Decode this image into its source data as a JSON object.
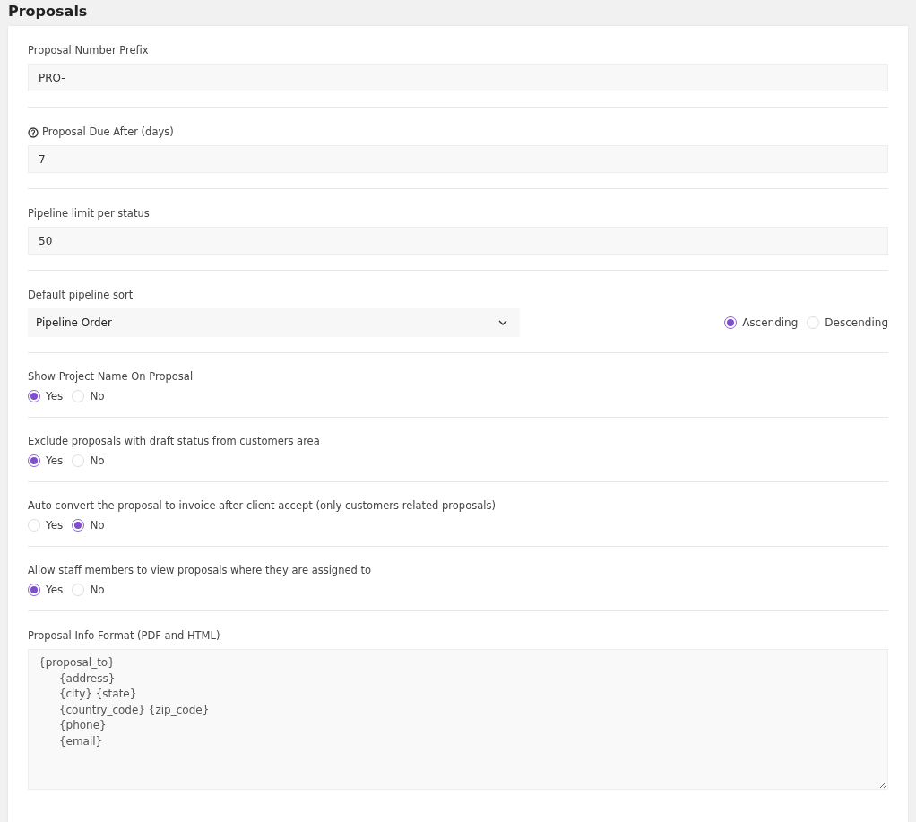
{
  "page": {
    "title": "Proposals"
  },
  "settings": [
    {
      "kind": "text",
      "label": "Proposal Number Prefix",
      "help_icon": false,
      "value": "PRO-"
    },
    {
      "kind": "text",
      "label": "Proposal Due After (days)",
      "help_icon": true,
      "value": "7"
    },
    {
      "kind": "text",
      "label": "Pipeline limit per status",
      "help_icon": false,
      "value": "50"
    },
    {
      "kind": "select",
      "label": "Default pipeline sort",
      "help_icon": false,
      "value": "Pipeline Order",
      "options": [
        {
          "label": "Ascending",
          "selected": true
        },
        {
          "label": "Descending",
          "selected": false
        }
      ]
    },
    {
      "kind": "radio",
      "label": "Show Project Name On Proposal",
      "help_icon": false,
      "options": [
        {
          "label": "Yes",
          "selected": true
        },
        {
          "label": "No",
          "selected": false
        }
      ]
    },
    {
      "kind": "radio",
      "label": "Exclude proposals with draft status from customers area",
      "help_icon": false,
      "options": [
        {
          "label": "Yes",
          "selected": true
        },
        {
          "label": "No",
          "selected": false
        }
      ]
    },
    {
      "kind": "radio",
      "label": "Auto convert the proposal to invoice after client accept (only customers related proposals)",
      "help_icon": false,
      "options": [
        {
          "label": "Yes",
          "selected": false
        },
        {
          "label": "No",
          "selected": true
        }
      ]
    },
    {
      "kind": "radio",
      "label": "Allow staff members to view proposals where they are assigned to",
      "help_icon": false,
      "options": [
        {
          "label": "Yes",
          "selected": true
        },
        {
          "label": "No",
          "selected": false
        }
      ]
    },
    {
      "kind": "textarea",
      "label": "Proposal Info Format (PDF and HTML)",
      "help_icon": false,
      "value": "{proposal_to}\n      {address}\n      {city} {state}\n      {country_code} {zip_code}\n      {phone}\n      {email}"
    }
  ]
}
